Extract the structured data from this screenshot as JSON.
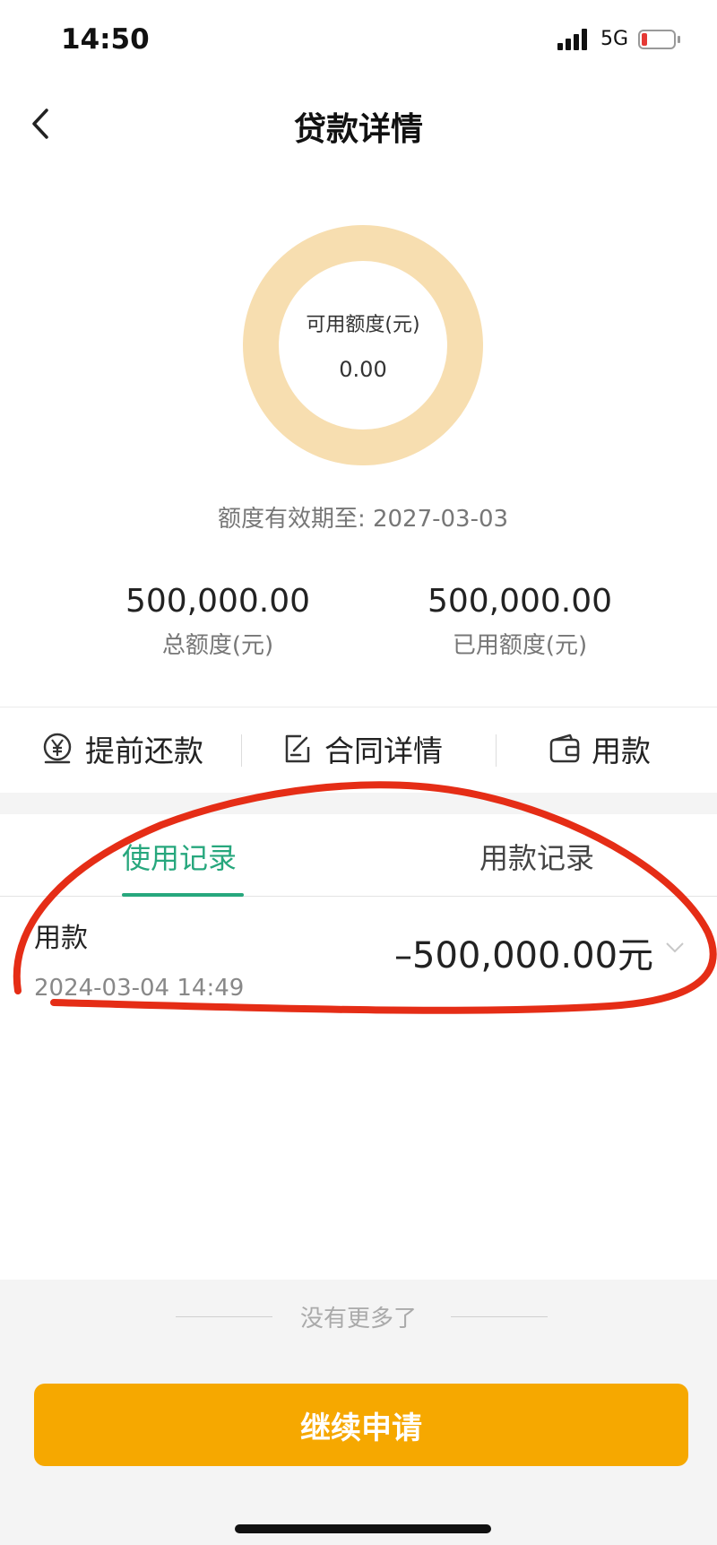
{
  "status_bar": {
    "time": "14:50",
    "network": "5G"
  },
  "header": {
    "title": "贷款详情"
  },
  "quota": {
    "available_label": "可用额度(元)",
    "available_value": "0.00",
    "validity": "额度有效期至: 2027-03-03",
    "total_value": "500,000.00",
    "total_label": "总额度(元)",
    "used_value": "500,000.00",
    "used_label": "已用额度(元)"
  },
  "actions": {
    "repay": "提前还款",
    "contract": "合同详情",
    "withdraw": "用款"
  },
  "tabs": {
    "usage": "使用记录",
    "withdraw": "用款记录"
  },
  "records": [
    {
      "type": "用款",
      "amount": "–500,000.00元",
      "date": "2024-03-04 14:49"
    }
  ],
  "footer": {
    "no_more": "没有更多了",
    "cta": "继续申请"
  },
  "colors": {
    "accent_green": "#27a77d",
    "ring": "#f7deb0",
    "cta": "#f6a800",
    "annotation": "#e52d16"
  },
  "icons": [
    "back-icon",
    "signal-icon",
    "battery-icon",
    "yen-circle-icon",
    "edit-document-icon",
    "wallet-icon",
    "chevron-down-icon"
  ]
}
